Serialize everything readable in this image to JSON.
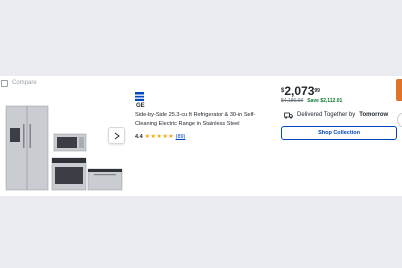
{
  "compare": {
    "label": "Compare"
  },
  "product": {
    "brand": "GE",
    "title": "Side-by-Side 25.3-cu ft Refrigerator & 30-in Self-Cleaning Electric Range in Stainless Steel",
    "rating": "4.4",
    "review_count": "(89)",
    "stars": {
      "value": 4.4,
      "max": 5
    }
  },
  "pricing": {
    "currency_symbol": "$",
    "dollars": "2,073",
    "cents": "99",
    "was": "$4,186.00",
    "save": "Save $2,112.01"
  },
  "delivery": {
    "text": "Delivered Together by",
    "day": "Tomorrow"
  },
  "actions": {
    "shop_collection": "Shop Collection"
  },
  "colors": {
    "accent_blue": "#0046be",
    "save_green": "#0a7a2e",
    "star": "#f2a900",
    "edge_tab": "#e0732a"
  }
}
